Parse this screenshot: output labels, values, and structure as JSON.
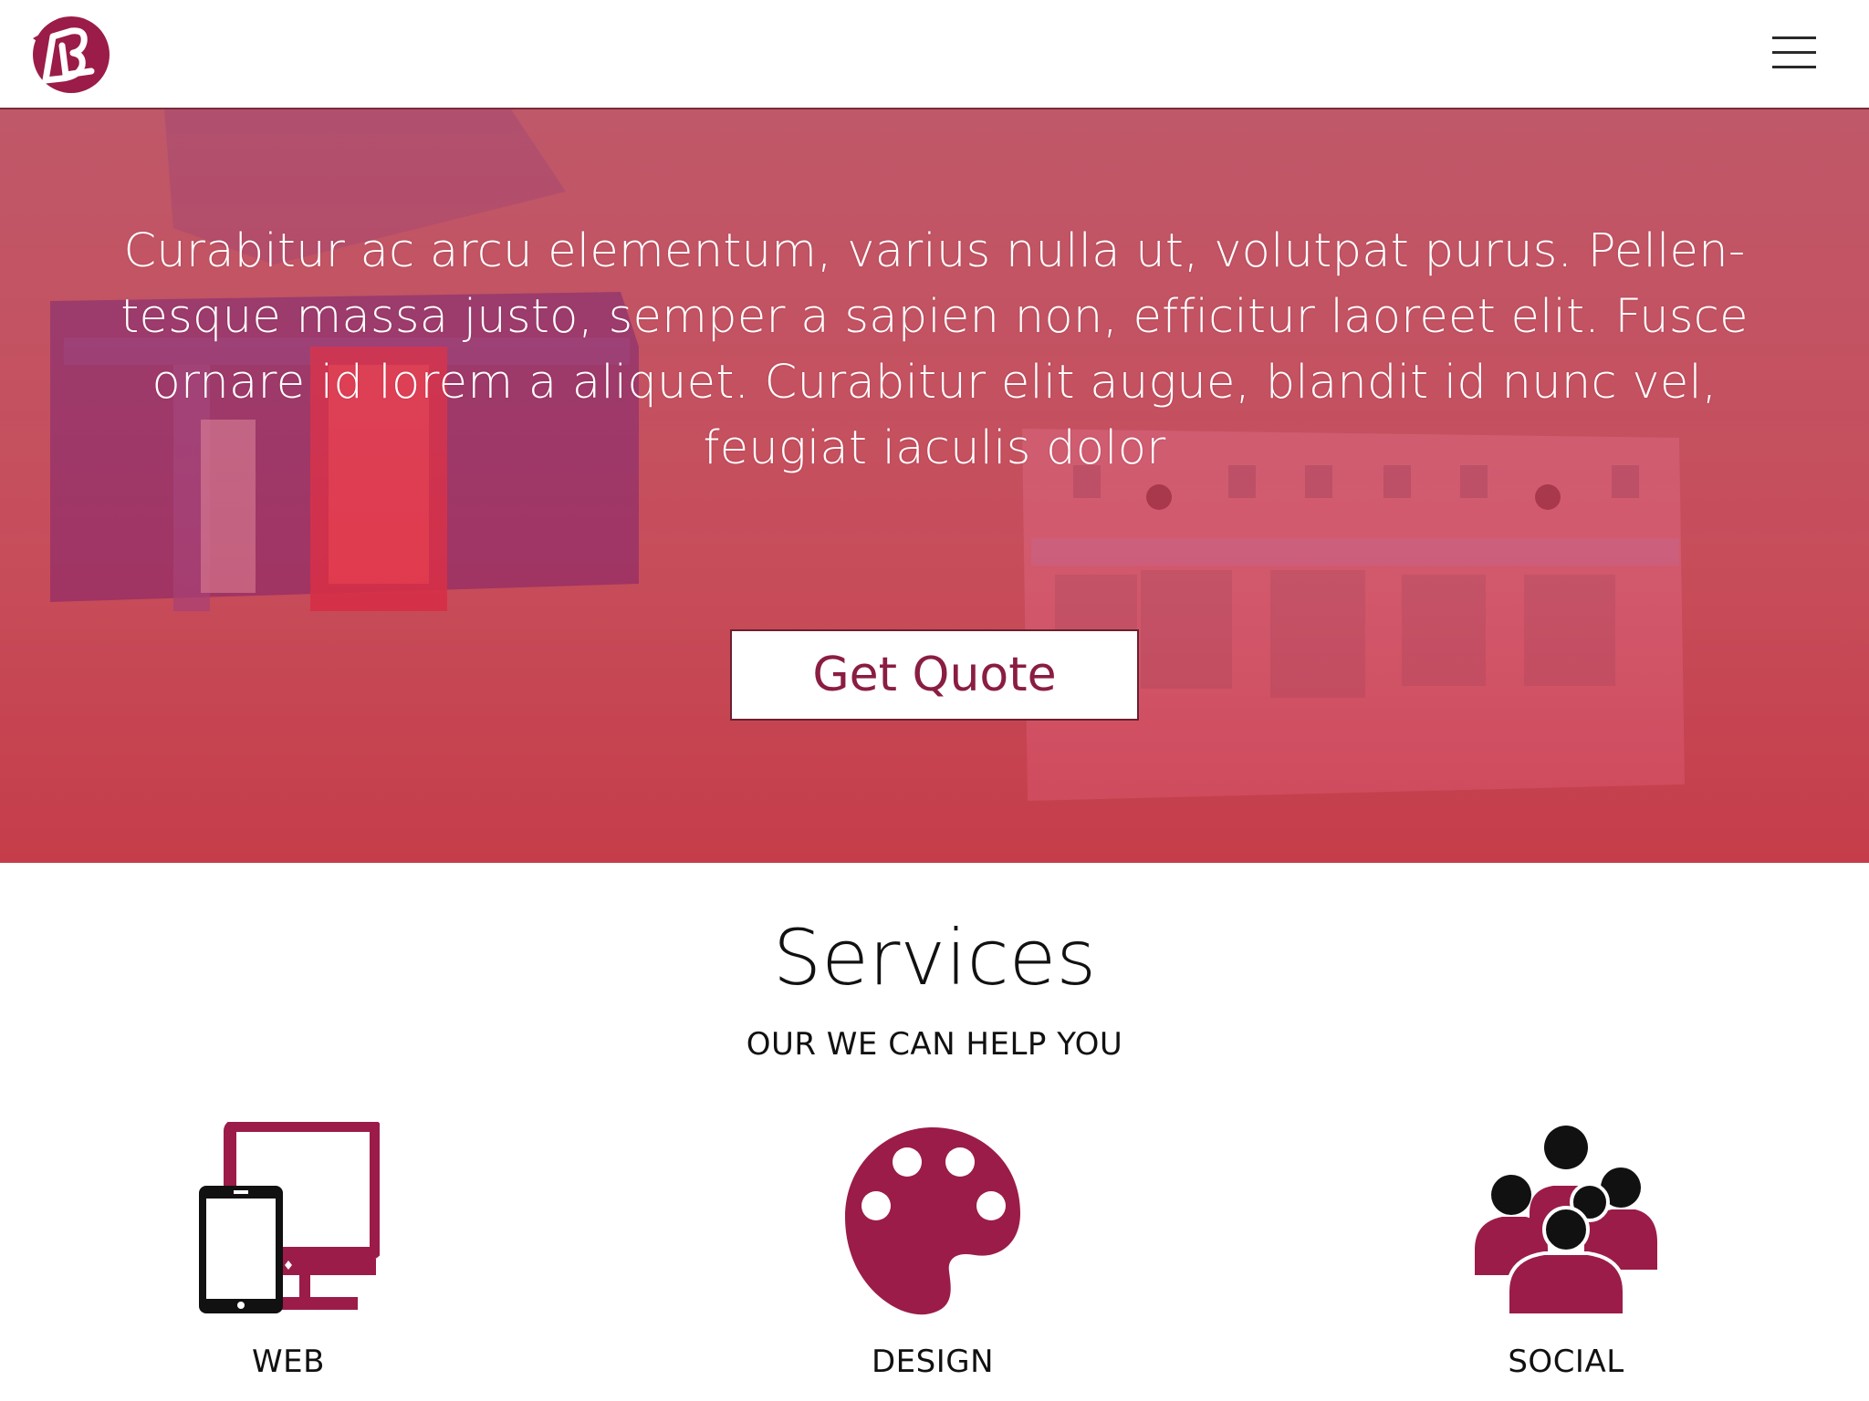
{
  "brand": {
    "logo_text": "BL",
    "accent_color": "#9b1c48"
  },
  "header": {
    "menu_icon": "hamburger-menu-icon"
  },
  "hero": {
    "text": "Curabitur ac arcu elementum, varius nulla ut, volutpat purus. Pellen-tesque massa justo, semper a sapien non, efficitur laoreet elit. Fusce ornare id lorem a aliquet. Curabitur elit augue, blandit id nunc vel, feugiat iaculis dolor",
    "cta_label": "Get Quote"
  },
  "services": {
    "title": "Services",
    "subtitle": "OUR WE CAN HELP YOU",
    "items": [
      {
        "label": "WEB",
        "icon": "devices-icon"
      },
      {
        "label": "DESIGN",
        "icon": "palette-icon"
      },
      {
        "label": "SOCIAL",
        "icon": "people-group-icon"
      }
    ]
  }
}
